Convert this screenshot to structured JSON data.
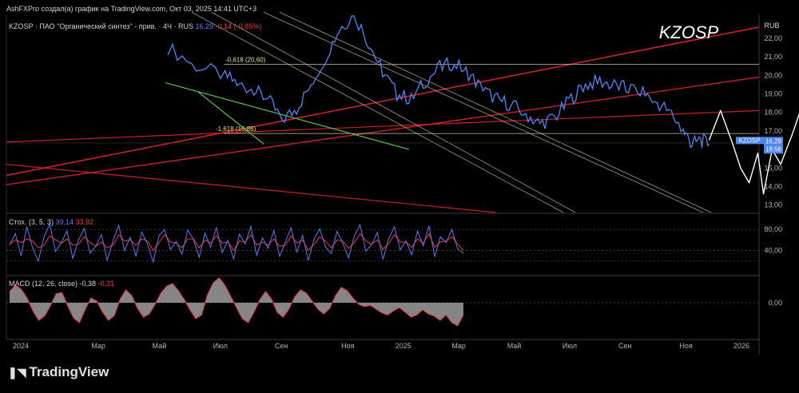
{
  "attribution": "AshFXPro создал(а) график на TradingView.com, Окт 03, 2025 14:41 UTC+3",
  "legend_main": {
    "symbol": "KZOSP",
    "name": "ПАО \"Органический синтез\" - прив.",
    "interval": "4Ч",
    "exchange": "RUS",
    "last": "16,29",
    "change": "-0,14 (-0,85%)"
  },
  "watermark": "KZOSP",
  "currency": "RUB",
  "price_badge": {
    "symbol": "KZOSP",
    "price": "16,29",
    "countdown": "18:56"
  },
  "fib_labels": [
    "-0,618 (20,60)",
    "-1,618 (16,86)"
  ],
  "stoch": {
    "label": "Стох. (3, 5, 3)",
    "k": "39,14",
    "d": "33,92",
    "colors": {
      "k": "#5b7bf0",
      "d": "#f23645"
    }
  },
  "macd": {
    "label": "MACD (12, 26, close)",
    "macd": "-0,38",
    "signal": "-0,31"
  },
  "brand": "TradingView",
  "colors": {
    "price": "#4f86f7",
    "redline": "#d11f2a",
    "greenline": "#59c24a",
    "channel": "#c8c89a",
    "projection": "#ffffff",
    "stoch_k": "#5b7bf0",
    "stoch_d": "#f23645",
    "macd_hist": "#9e9e9e",
    "macd_line": "#f23645"
  },
  "chart_data": [
    {
      "type": "line",
      "title": "KZOSP",
      "ylabel": "RUB",
      "ylim": [
        12.6,
        23.2
      ],
      "price_axis_ticks": [
        "22,00",
        "21,00",
        "20,00",
        "19,00",
        "18,00",
        "17,00",
        "16,00",
        "15,00",
        "14,00",
        "13,00"
      ],
      "time_axis_ticks": [
        "2024",
        "Мар",
        "Май",
        "Июл",
        "Сен",
        "Ноя",
        "2025",
        "Мар",
        "Май",
        "Июл",
        "Сен",
        "Ноя",
        "2026"
      ],
      "series": [
        {
          "values": [
            [
              0.0,
              21.5
            ],
            [
              0.1,
              20.5
            ],
            [
              0.2,
              20.0
            ],
            [
              0.25,
              19.5
            ],
            [
              0.3,
              19.2
            ],
            [
              0.35,
              18.7
            ],
            [
              0.4,
              17.6
            ],
            [
              0.45,
              18.2
            ],
            [
              0.5,
              19.5
            ],
            [
              0.55,
              21.0
            ],
            [
              0.6,
              22.5
            ],
            [
              0.65,
              23.3
            ],
            [
              0.7,
              21.8
            ],
            [
              0.75,
              20.2
            ],
            [
              0.8,
              19.0
            ],
            [
              0.85,
              18.7
            ],
            [
              0.9,
              19.7
            ],
            [
              0.95,
              20.4
            ],
            [
              1.0,
              20.7
            ],
            [
              1.05,
              20.1
            ],
            [
              1.1,
              19.2
            ],
            [
              1.15,
              18.7
            ],
            [
              1.2,
              18.4
            ],
            [
              1.25,
              17.9
            ],
            [
              1.3,
              17.4
            ],
            [
              1.35,
              17.7
            ],
            [
              1.4,
              18.6
            ],
            [
              1.45,
              19.4
            ],
            [
              1.5,
              19.7
            ],
            [
              1.55,
              19.5
            ],
            [
              1.6,
              19.3
            ],
            [
              1.65,
              19.2
            ],
            [
              1.7,
              18.6
            ],
            [
              1.75,
              18.1
            ],
            [
              1.8,
              17.0
            ],
            [
              1.83,
              16.3
            ],
            [
              1.86,
              16.5
            ],
            [
              1.89,
              16.29
            ]
          ]
        }
      ],
      "fib_levels": [
        20.6,
        16.86
      ],
      "projection": [
        [
          1.89,
          16.5
        ],
        [
          1.93,
          18.1
        ],
        [
          1.97,
          16.4
        ],
        [
          2.0,
          15.0
        ],
        [
          2.03,
          14.2
        ],
        [
          2.06,
          15.8
        ],
        [
          2.08,
          13.6
        ],
        [
          2.11,
          16.0
        ],
        [
          2.14,
          15.2
        ],
        [
          2.18,
          16.8
        ],
        [
          2.22,
          18.6
        ],
        [
          2.25,
          20.2
        ],
        [
          2.27,
          20.9
        ]
      ]
    },
    {
      "type": "line",
      "title": "Стох. (3, 5, 3)",
      "ylim": [
        0,
        100
      ],
      "ticks": [
        "80,00",
        "40,00"
      ],
      "series": [
        {
          "name": "Стох. (3, 5, 3)",
          "values": [
            50,
            72,
            30,
            85,
            45,
            20,
            66,
            90,
            38,
            55,
            77,
            25,
            60,
            82,
            35,
            48,
            70,
            22,
            58,
            88,
            40,
            65,
            30,
            75,
            52,
            18,
            68,
            80,
            42,
            57,
            33,
            79,
            61,
            27,
            73,
            46,
            84,
            36,
            59,
            24,
            71,
            53,
            86,
            31,
            64,
            44,
            78,
            29,
            56,
            83,
            37,
            69,
            21,
            62,
            81,
            47,
            34,
            76,
            54,
            26,
            67,
            89,
            39,
            51,
            74,
            23,
            63,
            85,
            41,
            58,
            32,
            77,
            49,
            87,
            28,
            66,
            55,
            80,
            43,
            35
          ]
        },
        {
          "name": "D",
          "values": [
            52,
            60,
            55,
            62,
            58,
            45,
            50,
            68,
            60,
            54,
            62,
            50,
            52,
            66,
            55,
            48,
            56,
            45,
            50,
            70,
            58,
            60,
            50,
            62,
            58,
            40,
            55,
            70,
            56,
            54,
            45,
            62,
            62,
            45,
            60,
            54,
            68,
            54,
            56,
            40,
            58,
            56,
            70,
            50,
            56,
            50,
            62,
            48,
            50,
            68,
            54,
            60,
            40,
            52,
            66,
            58,
            45,
            60,
            58,
            44,
            55,
            72,
            58,
            52,
            60,
            42,
            54,
            70,
            56,
            56,
            46,
            62,
            54,
            72,
            46,
            56,
            58,
            66,
            52,
            40
          ]
        }
      ]
    },
    {
      "type": "area",
      "title": "MACD (12, 26, close)",
      "ticks": [
        "0,00"
      ],
      "series": [
        {
          "name": "MACD (12, 26, close)",
          "values": [
            0.35,
            0.55,
            0.42,
            0.15,
            -0.25,
            -0.55,
            -0.42,
            -0.1,
            0.28,
            0.32,
            -0.1,
            -0.48,
            -0.62,
            -0.2,
            0.15,
            0.05,
            -0.3,
            -0.55,
            -0.4,
            0.12,
            0.4,
            0.22,
            -0.18,
            -0.45,
            -0.35,
            -0.05,
            0.3,
            0.52,
            0.6,
            0.38,
            0.1,
            -0.22,
            -0.5,
            -0.38,
            0.25,
            0.62,
            0.78,
            0.55,
            0.2,
            -0.15,
            -0.5,
            -0.62,
            -0.3,
            0.1,
            0.35,
            0.12,
            -0.3,
            -0.45,
            -0.2,
            0.18,
            0.4,
            0.3,
            0.05,
            -0.2,
            -0.35,
            -0.18,
            0.22,
            0.48,
            0.38,
            0.15,
            -0.05,
            -0.12,
            -0.08,
            -0.2,
            -0.32,
            -0.38,
            -0.25,
            -0.15,
            -0.3,
            -0.45,
            -0.38,
            -0.22,
            -0.35,
            -0.42,
            -0.55,
            -0.38,
            -0.62,
            -0.72,
            -0.38
          ]
        }
      ]
    }
  ]
}
